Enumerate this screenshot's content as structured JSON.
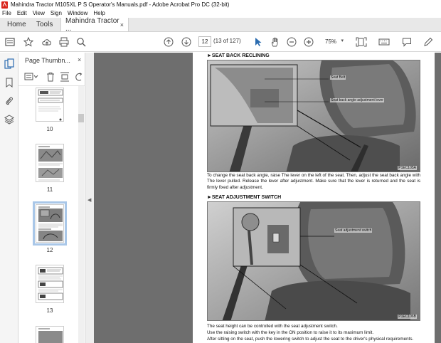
{
  "window": {
    "title": "Mahindra Tractor M105XL P S Operator's Manuals.pdf - Adobe Acrobat Pro DC (32-bit)"
  },
  "menu": [
    "File",
    "Edit",
    "View",
    "Sign",
    "Window",
    "Help"
  ],
  "tabs": {
    "home": "Home",
    "tools": "Tools",
    "document": "Mahindra Tractor ...",
    "close": "×"
  },
  "toolbar": {
    "page_number": "12",
    "page_count": "(13 of 127)",
    "zoom": "75%"
  },
  "thumbnails_panel": {
    "title": "Page Thumbn...",
    "close": "×",
    "pages": [
      {
        "label": "10"
      },
      {
        "label": "11"
      },
      {
        "label": "12",
        "selected": true
      },
      {
        "label": "13"
      }
    ]
  },
  "document": {
    "section1": {
      "heading": "►SEAT BACK RECLINING",
      "callout_belt": "Seat Belt",
      "callout_lever": "Seat back angle adjustment lever",
      "photo_code": "P1EC105A",
      "paragraph": "To change the seat back angle, raise The lever on the left of the seat. Then, adjust the seat back angle with The lever pulled. Release the lever after adjustment. Make sure that the lever is returned and the seat is firmly fixed after adjustment."
    },
    "section2": {
      "heading": "►SEAT ADJUSTMENT SWITCH",
      "callout_switch": "Seat adjustment switch",
      "photo_code": "P1EC106B",
      "lines": [
        "The seat height can be controlled with the seat adjustment switch.",
        "Use the raising switch with the key in the ON position to raise it to its maximum limit.",
        "After sitting on the seat, push the lowering switch to adjust the seat to the driver's physical requirements."
      ]
    }
  },
  "colors": {
    "acrobat_red": "#d9251c",
    "accent_blue": "#2b6cb0",
    "selection": "#a9c7e8"
  }
}
